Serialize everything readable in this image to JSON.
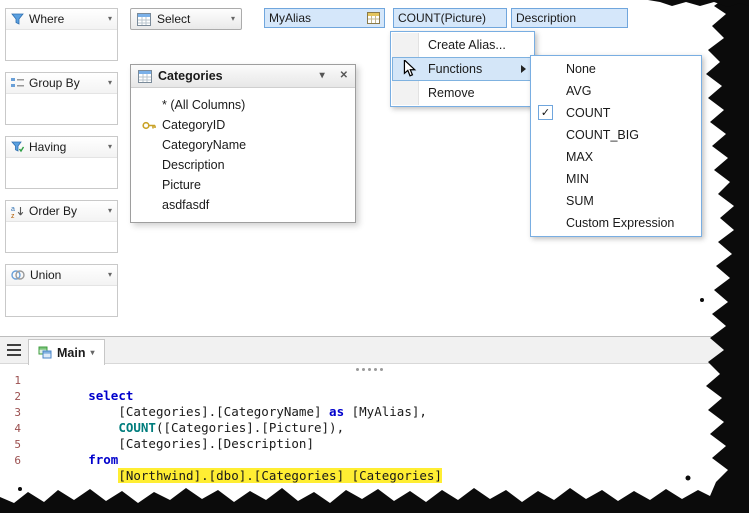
{
  "icons": {
    "chevron_down": "▾",
    "close": "✕",
    "check": "✓"
  },
  "left_panels": [
    {
      "label": "Where"
    },
    {
      "label": "Group By"
    },
    {
      "label": "Having"
    },
    {
      "label": "Order By"
    },
    {
      "label": "Union"
    }
  ],
  "select_bar": {
    "button_label": "Select",
    "chips": [
      {
        "label": "MyAlias"
      },
      {
        "label": "COUNT(Picture)"
      },
      {
        "label": "Description"
      }
    ]
  },
  "table_window": {
    "title": "Categories",
    "rows": [
      {
        "label": "* (All Columns)"
      },
      {
        "label": "CategoryID"
      },
      {
        "label": "CategoryName"
      },
      {
        "label": "Description"
      },
      {
        "label": "Picture"
      },
      {
        "label": "asdfasdf"
      }
    ]
  },
  "context_menu": {
    "items": [
      {
        "label": "Create Alias..."
      },
      {
        "label": "Functions"
      },
      {
        "label": "Remove"
      }
    ]
  },
  "functions_submenu": {
    "items": [
      {
        "label": "None",
        "checked": false
      },
      {
        "label": "AVG",
        "checked": false
      },
      {
        "label": "COUNT",
        "checked": true
      },
      {
        "label": "COUNT_BIG",
        "checked": false
      },
      {
        "label": "MAX",
        "checked": false
      },
      {
        "label": "MIN",
        "checked": false
      },
      {
        "label": "SUM",
        "checked": false
      },
      {
        "label": "Custom Expression",
        "checked": false
      }
    ]
  },
  "bottom_pane": {
    "tab_label": "Main",
    "sql": {
      "lines": [
        {
          "num": "1",
          "tokens": [
            {
              "t": "kw",
              "s": "select"
            }
          ]
        },
        {
          "num": "2",
          "tokens": [
            {
              "t": "txt",
              "s": "    [Categories].[CategoryName] "
            },
            {
              "t": "kw",
              "s": "as"
            },
            {
              "t": "txt",
              "s": " [MyAlias],"
            }
          ]
        },
        {
          "num": "3",
          "tokens": [
            {
              "t": "txt",
              "s": "    "
            },
            {
              "t": "fn",
              "s": "COUNT"
            },
            {
              "t": "txt",
              "s": "([Categories].[Picture]),"
            }
          ]
        },
        {
          "num": "4",
          "tokens": [
            {
              "t": "txt",
              "s": "    [Categories].[Description]"
            }
          ]
        },
        {
          "num": "5",
          "tokens": [
            {
              "t": "kw",
              "s": "from"
            }
          ]
        },
        {
          "num": "6",
          "tokens": [
            {
              "t": "txt",
              "s": "    "
            },
            {
              "t": "hl",
              "s": "[Northwind].[dbo].[Categories] [Categories]"
            }
          ]
        }
      ]
    }
  },
  "colors": {
    "selection_bg": "#d5e7fa",
    "selection_border": "#70a6dd",
    "keyword": "#0000cc",
    "function": "#007d7d",
    "highlight": "#ffee33"
  }
}
